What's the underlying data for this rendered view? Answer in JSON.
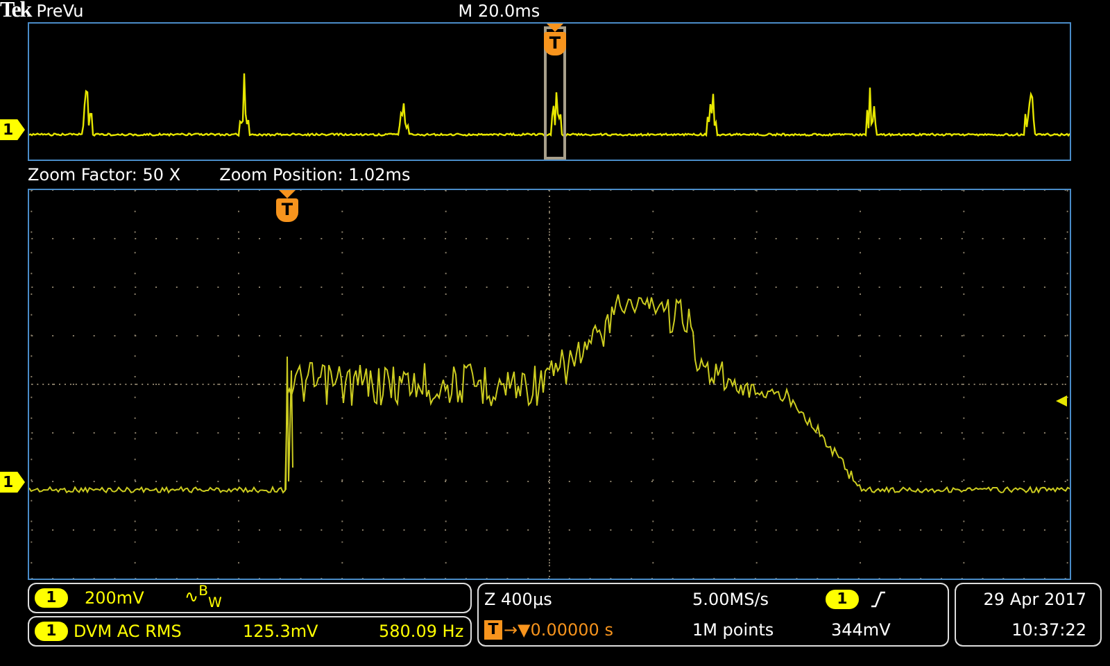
{
  "header": {
    "logo": "Tek",
    "mode": "PreVu",
    "timebase": "M 20.0ms"
  },
  "overview": {
    "channel": "1",
    "trigger": "T"
  },
  "zoom_info": {
    "factor": "Zoom Factor: 50 X",
    "position": "Zoom Position: 1.02ms"
  },
  "main": {
    "channel": "1",
    "trigger": "T"
  },
  "channel_status": {
    "channel": "1",
    "scale": "200mV",
    "bandwidth": "∿$^{B}$$_{W}$"
  },
  "dvm": {
    "channel": "1",
    "label": "DVM AC RMS",
    "value": "125.3mV",
    "frequency": "580.09 Hz"
  },
  "acquisition": {
    "zoom_scale": "Z 400µs",
    "sample_rate": "5.00MS/s",
    "trigger_marker": "T",
    "trigger_offset": "→▼0.00000 s",
    "record_length": "1M points"
  },
  "trigger": {
    "channel": "1",
    "level": "344mV"
  },
  "datetime": {
    "date": "29 Apr  2017",
    "time": "10:37:22"
  }
}
